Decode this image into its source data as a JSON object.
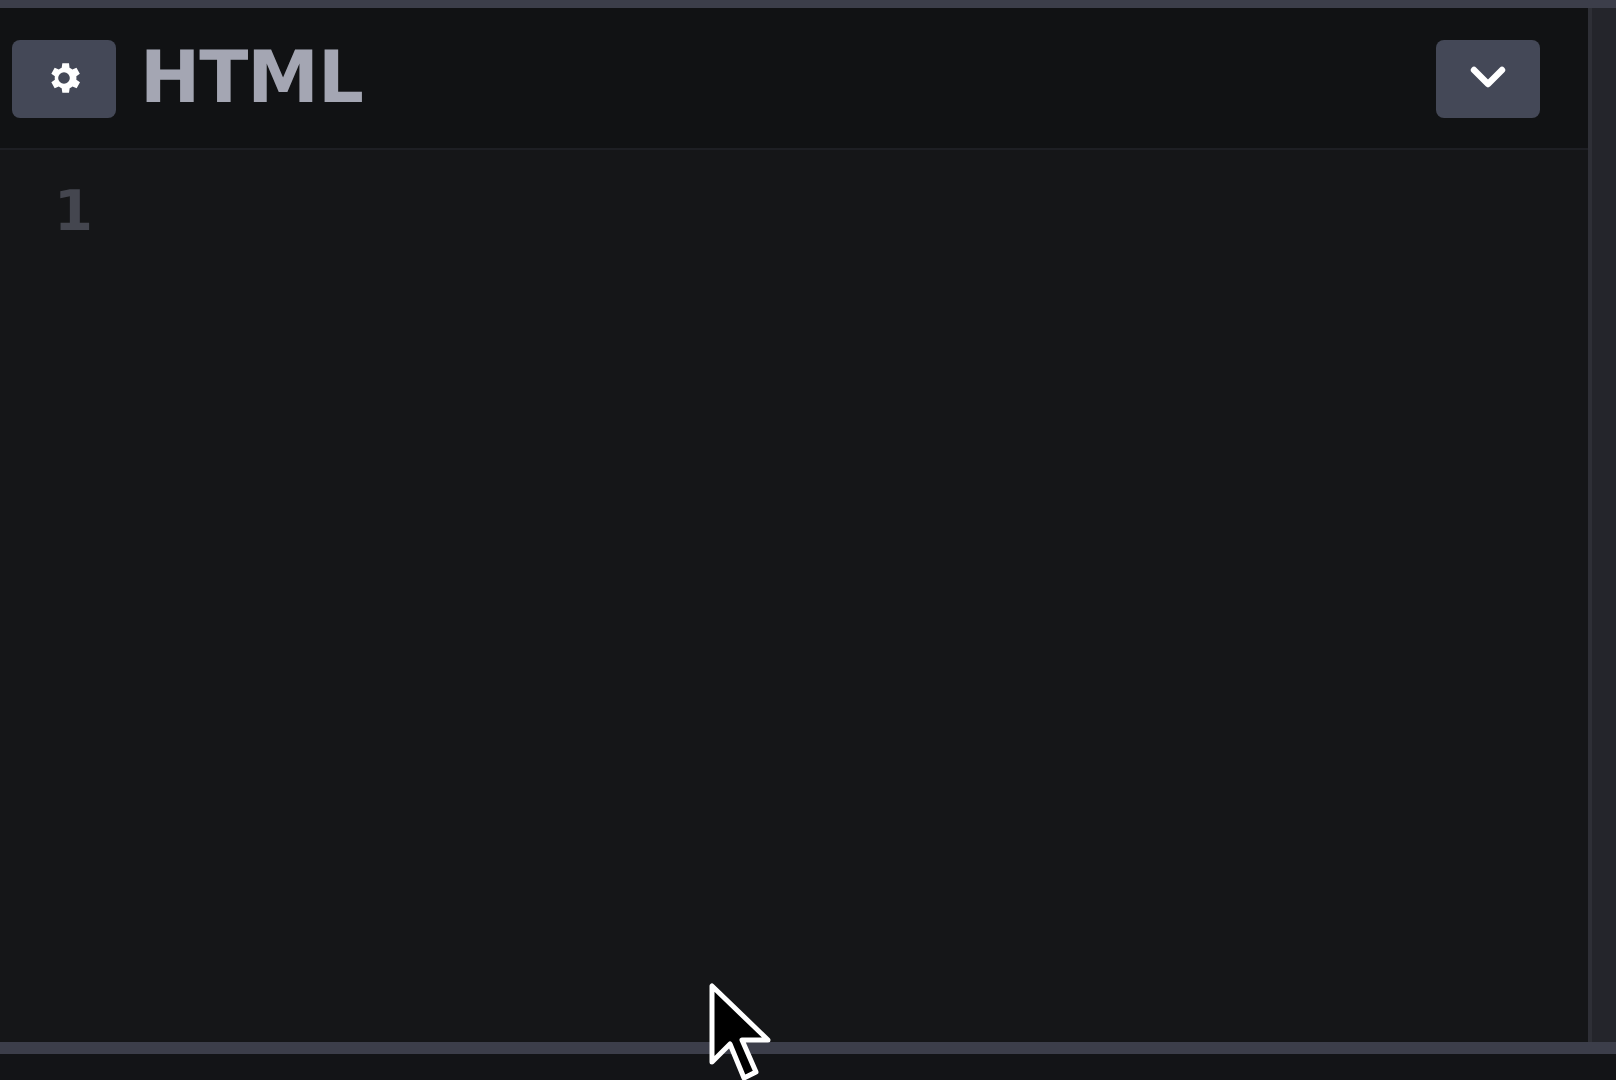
{
  "panel": {
    "title": "HTML"
  },
  "editor": {
    "line_numbers": [
      "1"
    ]
  }
}
